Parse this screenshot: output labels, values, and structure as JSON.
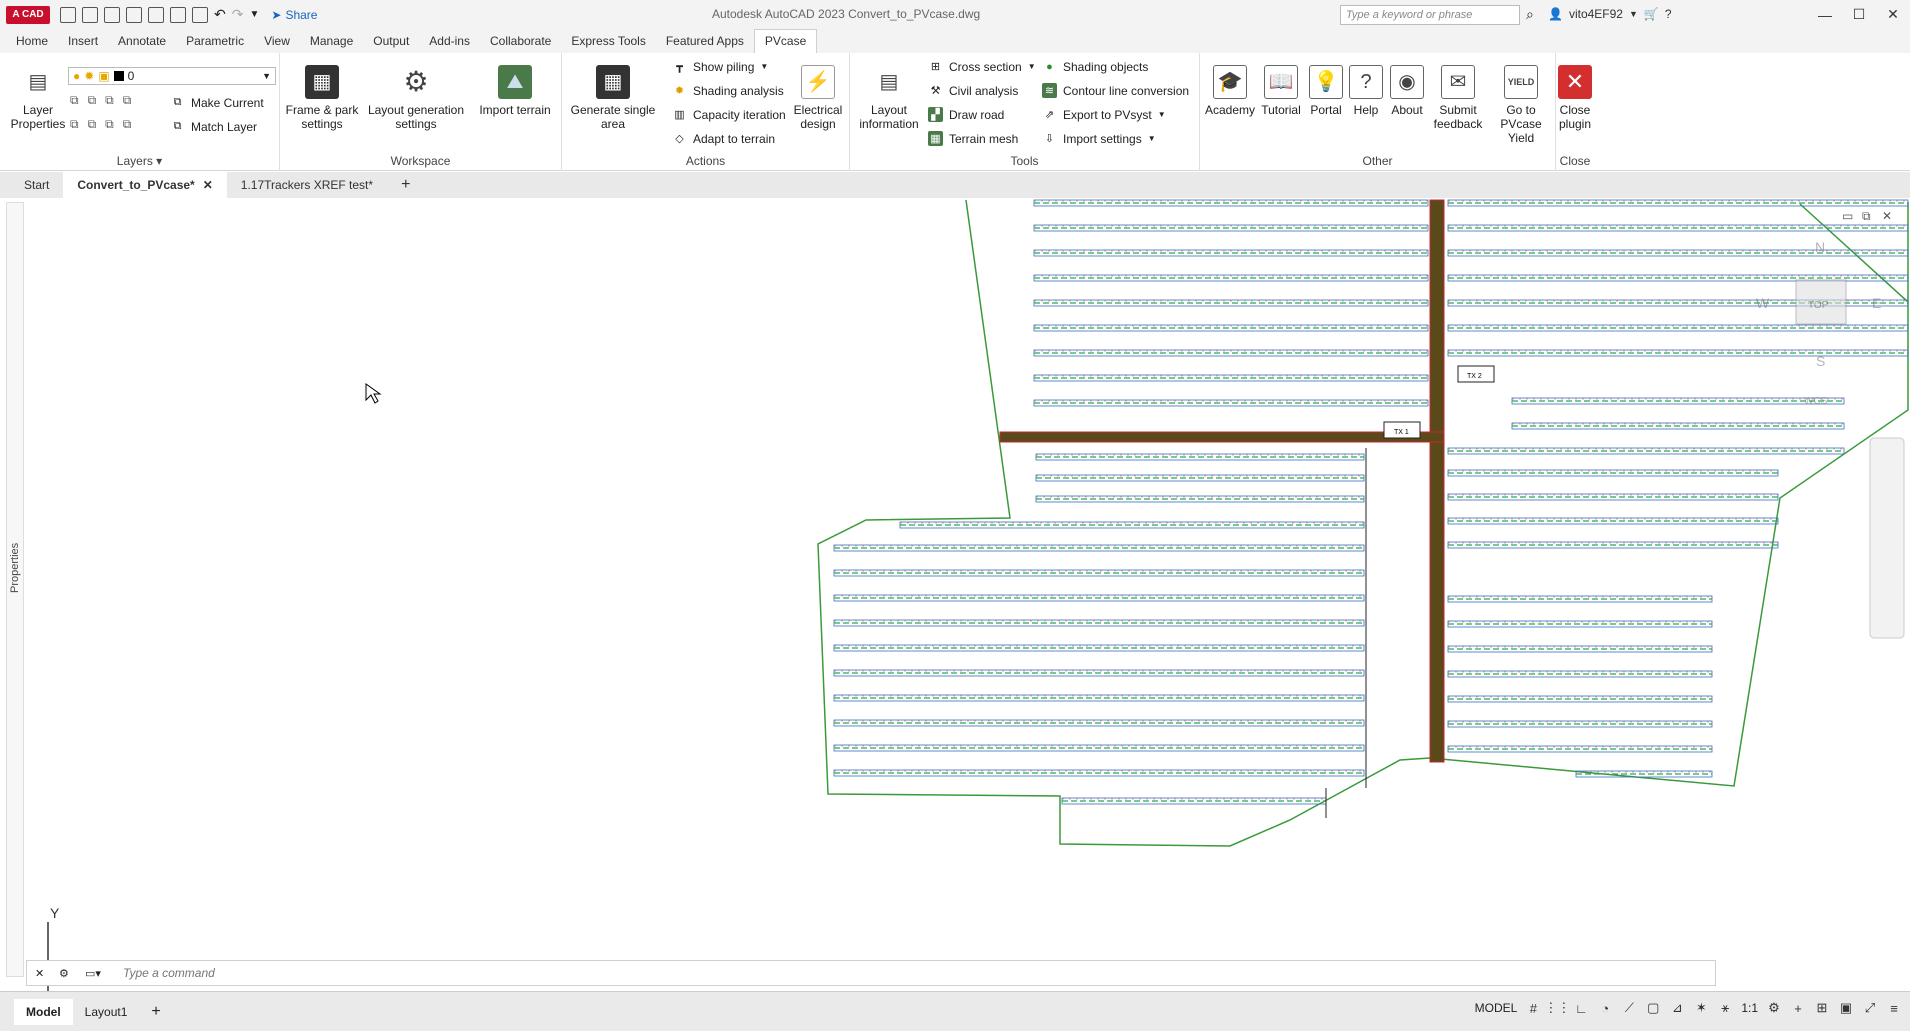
{
  "app": {
    "logo": "A CAD",
    "title": "Autodesk AutoCAD 2023   Convert_to_PVcase.dwg",
    "share": "Share",
    "search_placeholder": "Type a keyword or phrase",
    "user": "vito4EF92"
  },
  "ribbon_tabs": [
    "Home",
    "Insert",
    "Annotate",
    "Parametric",
    "View",
    "Manage",
    "Output",
    "Add-ins",
    "Collaborate",
    "Express Tools",
    "Featured Apps",
    "PVcase"
  ],
  "layers": {
    "layer_properties": "Layer Properties",
    "current_layer": "0",
    "make_current": "Make Current",
    "match_layer": "Match Layer",
    "title": "Layers"
  },
  "workspace": {
    "frame": "Frame & park settings",
    "layout": "Layout generation settings",
    "terrain": "Import terrain",
    "title": "Workspace"
  },
  "actions": {
    "generate": "Generate single area",
    "show_piling": "Show piling",
    "shading": "Shading analysis",
    "capacity": "Capacity iteration",
    "adapt": "Adapt to terrain",
    "electrical": "Electrical design",
    "title": "Actions"
  },
  "tools": {
    "layout_info": "Layout information",
    "cross_section": "Cross section",
    "civil": "Civil analysis",
    "draw_road": "Draw road",
    "terrain_mesh": "Terrain mesh",
    "shading_objects": "Shading objects",
    "contour": "Contour line conversion",
    "export": "Export to PVsyst",
    "import_settings": "Import settings",
    "title": "Tools"
  },
  "other": {
    "academy": "Academy",
    "tutorial": "Tutorial",
    "portal": "Portal",
    "help": "Help",
    "about": "About",
    "feedback": "Submit feedback",
    "yield": "Go to PVcase Yield",
    "title": "Other"
  },
  "close": {
    "close_plugin": "Close plugin",
    "title": "Close"
  },
  "doc_tabs": [
    "Start",
    "Convert_to_PVcase*",
    "1.17Trackers XREF test*"
  ],
  "drawing": {
    "tx1": "TX 1",
    "tx2": "TX 2",
    "viewcube": {
      "n": "N",
      "s": "S",
      "e": "E",
      "w": "W",
      "top": "TOP",
      "wcs": "WCS"
    },
    "ucs_y": "Y"
  },
  "properties_label": "Properties",
  "command_placeholder": "Type a command",
  "layout_tabs": [
    "Model",
    "Layout1"
  ],
  "status": {
    "model": "MODEL",
    "scale": "1:1"
  }
}
